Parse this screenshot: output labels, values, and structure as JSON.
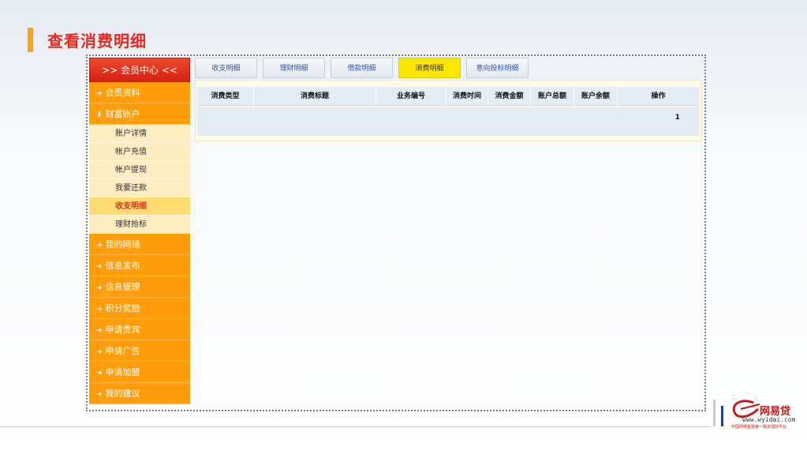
{
  "page": {
    "title": "查看消费明细"
  },
  "sidebar": {
    "header": ">> 会员中心 <<",
    "items": [
      {
        "label": "会员资料",
        "arrow": "➜"
      },
      {
        "label": "财富账户",
        "arrow": "⬇"
      }
    ],
    "sub_items": [
      "账户详情",
      "帐户充值",
      "帐户提现",
      "我要还款",
      "收支明细",
      "理财抢标"
    ],
    "more_items": [
      "我的网铺",
      "信息发布",
      "信息管理",
      "积分奖励",
      "申请贵宾",
      "申请广告",
      "申请加盟",
      "我的建议"
    ],
    "more_arrow": "➜",
    "active_sub": "收支明细"
  },
  "tabs": [
    "收支明细",
    "理财明细",
    "借款明细",
    "消费明细",
    "意向投标明细"
  ],
  "active_tab": "消费明细",
  "table": {
    "columns": [
      "消费类型",
      "消费标题",
      "业务编号",
      "消费时间",
      "消费金额",
      "账户总额",
      "账户余额",
      "操作"
    ],
    "page_number": "1"
  },
  "logo": {
    "name": "网易贷",
    "url": "www.wyidai.com",
    "tagline": "中国网络金融第一融资理财平台",
    "colors": {
      "accent": "#c21a17",
      "bar_blue": "#1f3f8f"
    }
  },
  "colors": {
    "title": "#e8281d",
    "sidebar_orange": "#ff9d0c",
    "sidebar_header": "#d61f12",
    "active_tab": "#ffe600"
  }
}
